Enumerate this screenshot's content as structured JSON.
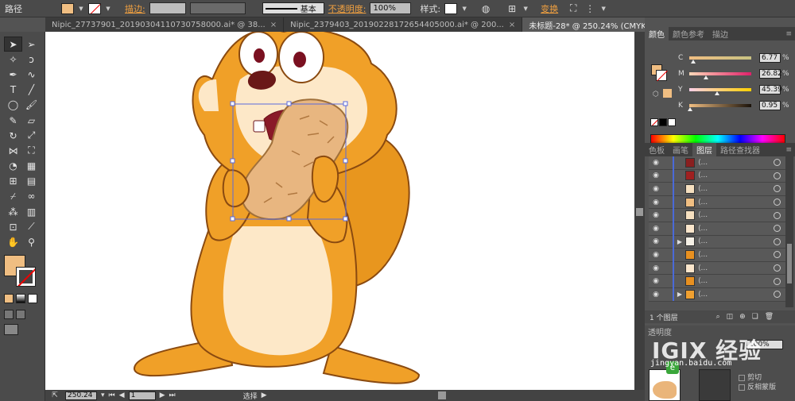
{
  "control_bar": {
    "path_label": "路径",
    "fill_color": "#F0BE82",
    "stroke_label": "描边:",
    "stroke_style": "基本",
    "opacity_label": "不透明度:",
    "opacity_value": "100%",
    "style_label": "样式:",
    "transform_label": "变换"
  },
  "tabs": [
    {
      "label": "Nipic_27737901_20190304110730758000.ai* @ 38...",
      "active": false
    },
    {
      "label": "Nipic_2379403_20190228172654405000.ai* @ 200...",
      "active": false
    },
    {
      "label": "未标题-28* @ 250.24% (CMYK/预览)",
      "active": true
    }
  ],
  "tools": [
    {
      "name": "selection-tool",
      "icon": "arrow-icon",
      "glyph": "➤"
    },
    {
      "name": "direct-selection-tool",
      "icon": "hollow-arrow-icon",
      "glyph": "➢"
    },
    {
      "name": "magic-wand-tool",
      "icon": "magic-wand-icon",
      "glyph": "✧"
    },
    {
      "name": "lasso-tool",
      "icon": "lasso-icon",
      "glyph": "ↄ"
    },
    {
      "name": "pen-tool",
      "icon": "pen-icon",
      "glyph": "✒"
    },
    {
      "name": "curvature-tool",
      "icon": "curvature-icon",
      "glyph": "∿"
    },
    {
      "name": "type-tool",
      "icon": "type-icon",
      "glyph": "T"
    },
    {
      "name": "line-tool",
      "icon": "line-icon",
      "glyph": "╱"
    },
    {
      "name": "ellipse-tool",
      "icon": "ellipse-icon",
      "glyph": "◯"
    },
    {
      "name": "paintbrush-tool",
      "icon": "brush-icon",
      "glyph": "🖌"
    },
    {
      "name": "pencil-tool",
      "icon": "pencil-icon",
      "glyph": "✎"
    },
    {
      "name": "eraser-tool",
      "icon": "eraser-icon",
      "glyph": "▱"
    },
    {
      "name": "rotate-tool",
      "icon": "rotate-icon",
      "glyph": "↻"
    },
    {
      "name": "scale-tool",
      "icon": "scale-icon",
      "glyph": "⤢"
    },
    {
      "name": "width-tool",
      "icon": "width-icon",
      "glyph": "⋈"
    },
    {
      "name": "free-transform-tool",
      "icon": "free-transform-icon",
      "glyph": "⛶"
    },
    {
      "name": "shape-builder-tool",
      "icon": "shape-builder-icon",
      "glyph": "◔"
    },
    {
      "name": "perspective-grid-tool",
      "icon": "perspective-icon",
      "glyph": "▦"
    },
    {
      "name": "mesh-tool",
      "icon": "mesh-icon",
      "glyph": "⊞"
    },
    {
      "name": "gradient-tool",
      "icon": "gradient-icon",
      "glyph": "▤"
    },
    {
      "name": "eyedropper-tool",
      "icon": "eyedropper-icon",
      "glyph": "⌿"
    },
    {
      "name": "blend-tool",
      "icon": "blend-icon",
      "glyph": "∞"
    },
    {
      "name": "symbol-sprayer-tool",
      "icon": "spray-icon",
      "glyph": "⁂"
    },
    {
      "name": "column-graph-tool",
      "icon": "graph-icon",
      "glyph": "▥"
    },
    {
      "name": "artboard-tool",
      "icon": "artboard-icon",
      "glyph": "⊡"
    },
    {
      "name": "slice-tool",
      "icon": "slice-icon",
      "glyph": "⟋"
    },
    {
      "name": "hand-tool",
      "icon": "hand-icon",
      "glyph": "✋"
    },
    {
      "name": "zoom-tool",
      "icon": "zoom-icon",
      "glyph": "⚲"
    }
  ],
  "color_panel": {
    "tabs": [
      "颜色",
      "颜色参考",
      "描边"
    ],
    "fill_color": "#F0BE82",
    "channels": [
      {
        "name": "C",
        "value": "6.77",
        "pos": 0.0677,
        "gradient": "linear-gradient(to right,#f0be82,#c8c282)"
      },
      {
        "name": "M",
        "value": "26.82",
        "pos": 0.2682,
        "gradient": "linear-gradient(to right,#ffd8b8,#e0206a)"
      },
      {
        "name": "Y",
        "value": "45.39",
        "pos": 0.4539,
        "gradient": "linear-gradient(to right,#ffd0e8,#ffd000)"
      },
      {
        "name": "K",
        "value": "0.95",
        "pos": 0.0095,
        "gradient": "linear-gradient(to right,#f0be82,#1a120a)"
      }
    ],
    "percent": "%"
  },
  "layers_panel": {
    "tabs": [
      "色板",
      "画笔",
      "图层",
      "路径查找器"
    ],
    "footer_label": "1 个图层",
    "rows": [
      {
        "color": "#8a2020",
        "arrow": ""
      },
      {
        "color": "#a02020",
        "arrow": ""
      },
      {
        "color": "#f6e0c0",
        "arrow": ""
      },
      {
        "color": "#f0be82",
        "arrow": ""
      },
      {
        "color": "#f6e0c0",
        "arrow": ""
      },
      {
        "color": "#fbe6cc",
        "arrow": ""
      },
      {
        "color": "#f5f0e6",
        "arrow": "▶"
      },
      {
        "color": "#e89020",
        "arrow": ""
      },
      {
        "color": "#fbe6cc",
        "arrow": ""
      },
      {
        "color": "#e89020",
        "arrow": ""
      },
      {
        "color": "#f0a030",
        "arrow": "▶"
      }
    ]
  },
  "lower_panel": {
    "tab": "透明度",
    "opacity_value": "100%",
    "clip_label": "剪切",
    "invert_label": "反相蒙版"
  },
  "watermark": {
    "text": "IGIX 经验",
    "sub": "jingyan.baidu.com"
  },
  "status_bar": {
    "zoom_value": "250.24",
    "page_value": "1",
    "mode_label": "选择"
  }
}
